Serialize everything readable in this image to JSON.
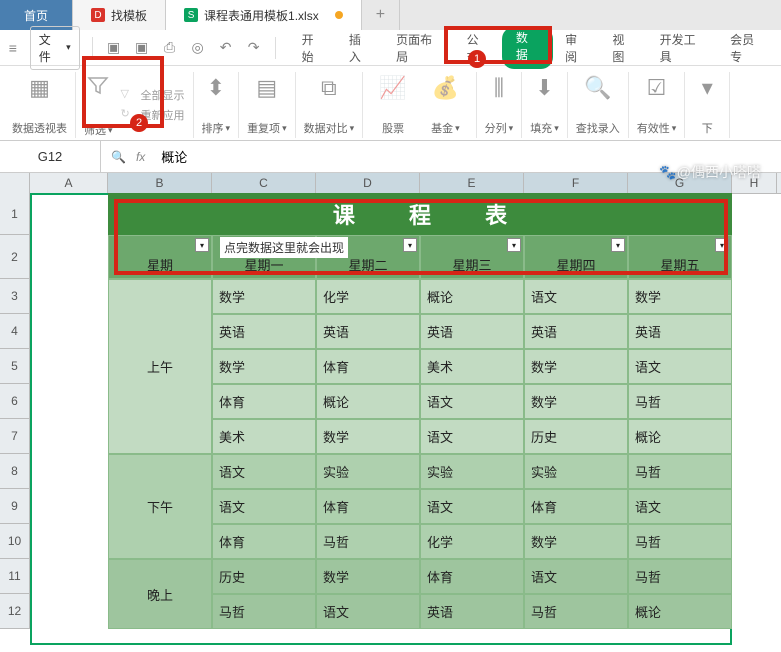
{
  "tabs": {
    "home": "首页",
    "template": "找模板",
    "file": "课程表通用模板1.xlsx"
  },
  "menu": {
    "file": "文件",
    "tabs": [
      "开始",
      "插入",
      "页面布局",
      "公式",
      "数据",
      "审阅",
      "视图",
      "开发工具",
      "会员专"
    ]
  },
  "ribbon": {
    "pivot": "数据透视表",
    "filter": "筛选",
    "show_all": "全部显示",
    "reapply": "重新应用",
    "sort": "排序",
    "dedup": "重复项",
    "compare": "数据对比",
    "stock": "股票",
    "fund": "基金",
    "split": "分列",
    "fill": "填充",
    "find_entry": "查找录入",
    "validate": "有效性",
    "dropdown": "下"
  },
  "badges": {
    "b1": "1",
    "b2": "2"
  },
  "formula": {
    "cell_ref": "G12",
    "value": "概论"
  },
  "columns": [
    "A",
    "B",
    "C",
    "D",
    "E",
    "F",
    "G",
    "H"
  ],
  "rows": [
    "1",
    "2",
    "3",
    "4",
    "5",
    "6",
    "7",
    "8",
    "9",
    "10",
    "11",
    "12"
  ],
  "chart_data": {
    "type": "table",
    "title": "课  程  表",
    "tooltip": "点完数据这里就会出现",
    "col_headers": [
      "星期",
      "星期一",
      "星期二",
      "星期三",
      "星期四",
      "星期五"
    ],
    "sections": [
      {
        "label": "上午",
        "rows": [
          [
            "数学",
            "化学",
            "概论",
            "语文",
            "数学"
          ],
          [
            "英语",
            "英语",
            "英语",
            "英语",
            "英语"
          ],
          [
            "数学",
            "体育",
            "美术",
            "数学",
            "语文"
          ],
          [
            "体育",
            "概论",
            "语文",
            "数学",
            "马哲"
          ],
          [
            "美术",
            "数学",
            "语文",
            "历史",
            "概论"
          ]
        ]
      },
      {
        "label": "下午",
        "rows": [
          [
            "语文",
            "实验",
            "实验",
            "实验",
            "马哲"
          ],
          [
            "语文",
            "体育",
            "语文",
            "体育",
            "语文"
          ],
          [
            "体育",
            "马哲",
            "化学",
            "数学",
            "马哲"
          ]
        ]
      },
      {
        "label": "晚上",
        "rows": [
          [
            "历史",
            "数学",
            "体育",
            "语文",
            "马哲"
          ],
          [
            "马哲",
            "语文",
            "英语",
            "马哲",
            "概论"
          ]
        ]
      }
    ]
  },
  "watermark": "@偶西小嗒嗒"
}
